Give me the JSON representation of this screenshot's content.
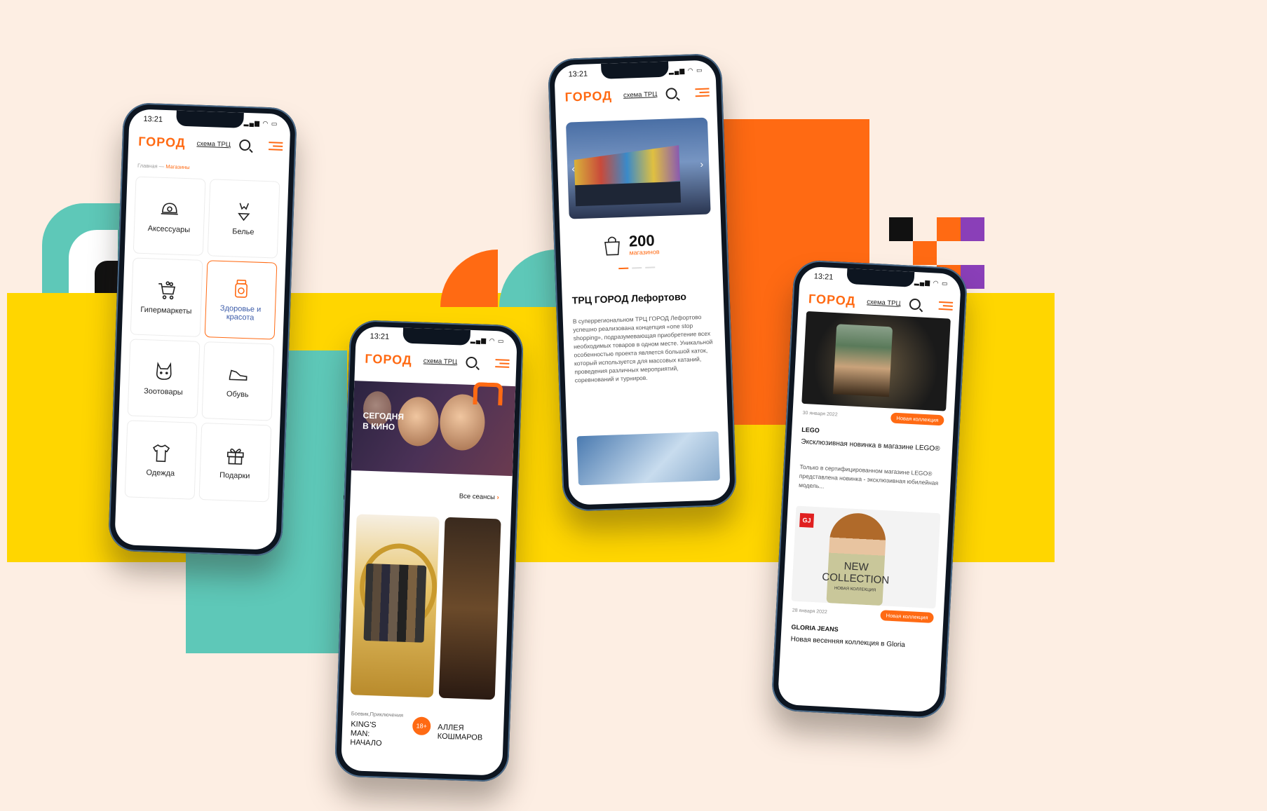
{
  "colors": {
    "bg": "#fdeee3",
    "orange": "#ff6a13",
    "yellow": "#ffd600",
    "teal": "#5ec8b8",
    "purple": "#8a3fb8",
    "dark": "#0d1520"
  },
  "common": {
    "time": "13:21",
    "logo": "ГОРОД",
    "scheme": "схема ТРЦ"
  },
  "phone_shops": {
    "breadcrumb_home": "Главная",
    "breadcrumb_sep": "—",
    "breadcrumb_current": "Магазины",
    "categories": [
      {
        "label": "Аксессуары",
        "icon": "cap-icon"
      },
      {
        "label": "Белье",
        "icon": "lingerie-icon"
      },
      {
        "label": "Гипермаркеты",
        "icon": "cart-icon"
      },
      {
        "label": "Здоровье и красота",
        "icon": "cosmetics-jar-icon",
        "active": true
      },
      {
        "label": "Зоотовары",
        "icon": "cat-icon"
      },
      {
        "label": "Обувь",
        "icon": "sneaker-icon"
      },
      {
        "label": "Одежда",
        "icon": "tshirt-icon"
      },
      {
        "label": "Подарки",
        "icon": "gift-icon"
      }
    ]
  },
  "phone_cinema": {
    "banner": "СЕГОДНЯ В КИНО",
    "all_sessions": "Все сеансы",
    "arrow": "›",
    "genre": "Боевик,Приключения",
    "movie1": "KING'S MAN: НАЧАЛО",
    "movie2": "АЛЛЕЯ КОШМАРОВ",
    "age": "18+"
  },
  "phone_mall": {
    "count": "200",
    "count_label": "магазинов",
    "title": "ТРЦ ГОРОД Лефортово",
    "description": "В суперрегиональном ТРЦ ГОРОД Лефортово успешно реализована концепция «one stop shopping», подразумевающая приобретение всех необходимых товаров в одном месте. Уникальной особенностью проекта является большой каток, который используется для массовых катаний, проведения различных мероприятий, соревнований и турниров."
  },
  "phone_news": {
    "items": [
      {
        "date": "30 января 2022",
        "badge": "Новая коллекция",
        "brand": "LEGO",
        "title": "Эксклюзивная новинка в магазине LEGO®",
        "text": "Только в сертифицированном магазине LEGO® представлена новинка - эксклюзивная юбилейная модель..."
      },
      {
        "date": "28 января 2022",
        "badge": "Новая коллекция",
        "brand": "GLORIA JEANS",
        "title": "Новая весенняя коллекция в Gloria",
        "poster_text": "NEW COLLECTION",
        "poster_sub": "НОВАЯ КОЛЛЕКЦИЯ",
        "logo": "GJ"
      }
    ]
  }
}
